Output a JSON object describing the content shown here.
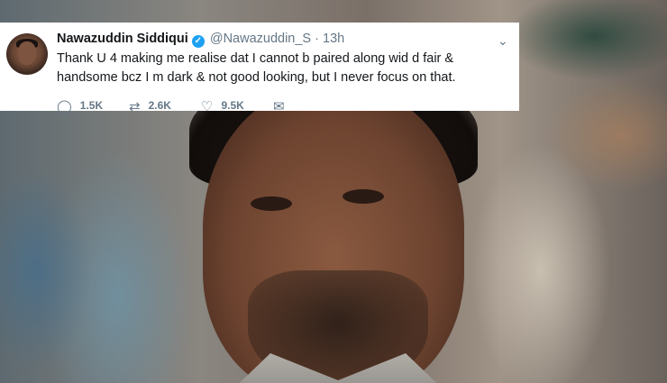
{
  "tweet": {
    "author_name": "Nawazuddin Siddiqui",
    "verified_icon": "✓",
    "handle": "@Nawazuddin_S",
    "separator": "·",
    "time": "13h",
    "menu_icon": "⌄",
    "text": "Thank U 4 making me realise dat I cannot b paired along wid d fair & handsome bcz I m dark & not good looking, but I never focus on that.",
    "actions": {
      "reply": {
        "icon": "reply-icon",
        "glyph": "◯",
        "count": "1.5K"
      },
      "retweet": {
        "icon": "retweet-icon",
        "glyph": "⇄",
        "count": "2.6K"
      },
      "like": {
        "icon": "heart-icon",
        "glyph": "♡",
        "count": "9.5K"
      },
      "dm": {
        "icon": "envelope-icon",
        "glyph": "✉"
      }
    }
  },
  "colors": {
    "verified_blue": "#1da1f2",
    "secondary_text": "#657786",
    "primary_text": "#14171a"
  }
}
